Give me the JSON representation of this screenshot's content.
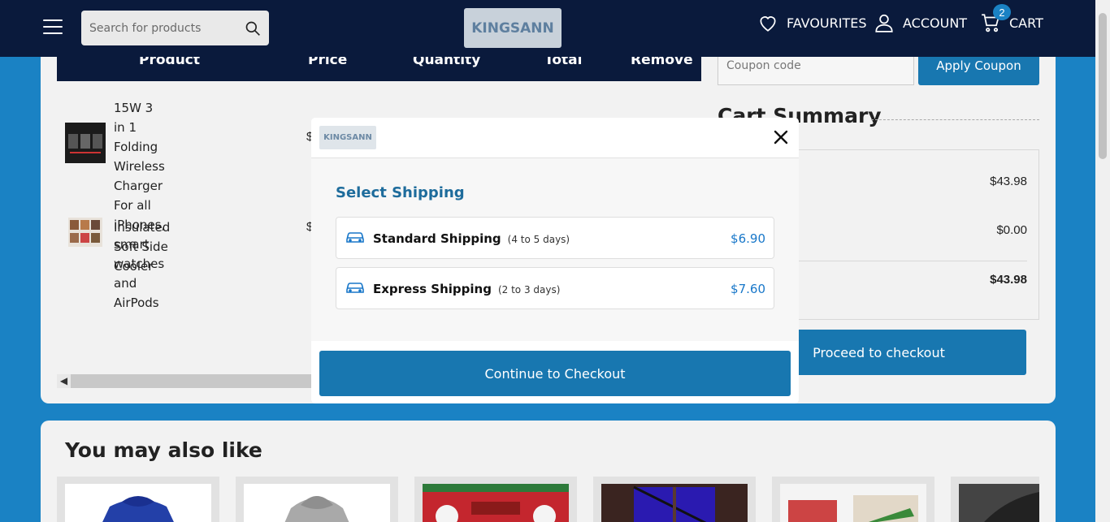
{
  "header": {
    "search_placeholder": "Search for products",
    "logo_text": "KINGSANN",
    "favourites_label": "FAVOURITES",
    "account_label": "ACCOUNT",
    "cart_label": "CART",
    "cart_count": "2"
  },
  "cart_table": {
    "columns": [
      "Product",
      "Price",
      "Quantity",
      "Total",
      "Remove"
    ],
    "rows": [
      {
        "title_lines": [
          "15W 3 in 1 Folding",
          "Wireless Charger For all",
          "iPhones, smart watches",
          "and AirPods"
        ],
        "price_fragment": "$"
      },
      {
        "title_lines": [
          "Insulated Soft Side Cooler"
        ],
        "price_fragment": "$"
      }
    ]
  },
  "coupon": {
    "placeholder": "Coupon code",
    "apply_label": "Apply Coupon"
  },
  "summary": {
    "title": "Cart Summary",
    "subtotal": "$43.98",
    "shipping": "$0.00",
    "total": "$43.98",
    "proceed_label": "Proceed to checkout"
  },
  "also_like": {
    "title": "You may also like"
  },
  "modal": {
    "logo_text": "KINGSANN",
    "title": "Select Shipping",
    "options": [
      {
        "name": "Standard Shipping",
        "days": "(4 to 5 days)",
        "price": "$6.90"
      },
      {
        "name": "Express Shipping",
        "days": "(2 to 3 days)",
        "price": "$7.60"
      }
    ],
    "continue_label": "Continue to Checkout"
  },
  "colors": {
    "navy": "#0a1a3c",
    "brand_blue": "#1877b0",
    "page_blue": "#1a82c4",
    "price_blue": "#1877c9"
  }
}
